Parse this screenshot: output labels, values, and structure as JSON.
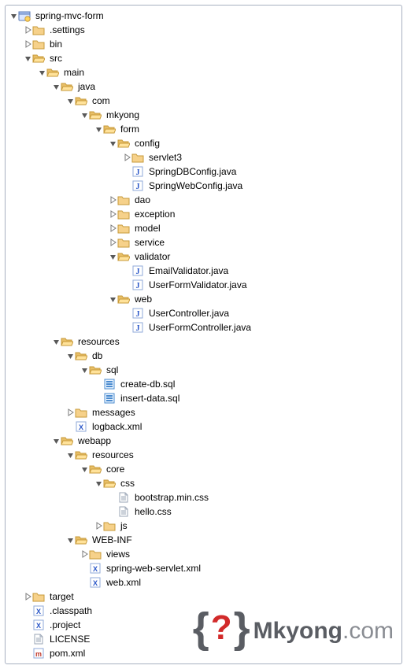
{
  "watermark": {
    "brand": "Mkyong",
    "suffix": ".com"
  },
  "tree": [
    {
      "depth": 0,
      "expand": "open",
      "icon": "project",
      "label": "spring-mvc-form"
    },
    {
      "depth": 1,
      "expand": "closed",
      "icon": "folder",
      "label": ".settings"
    },
    {
      "depth": 1,
      "expand": "closed",
      "icon": "folder",
      "label": "bin"
    },
    {
      "depth": 1,
      "expand": "open",
      "icon": "folder-open",
      "label": "src"
    },
    {
      "depth": 2,
      "expand": "open",
      "icon": "folder-open",
      "label": "main"
    },
    {
      "depth": 3,
      "expand": "open",
      "icon": "folder-open",
      "label": "java"
    },
    {
      "depth": 4,
      "expand": "open",
      "icon": "folder-open",
      "label": "com"
    },
    {
      "depth": 5,
      "expand": "open",
      "icon": "folder-open",
      "label": "mkyong"
    },
    {
      "depth": 6,
      "expand": "open",
      "icon": "folder-open",
      "label": "form"
    },
    {
      "depth": 7,
      "expand": "open",
      "icon": "folder-open",
      "label": "config"
    },
    {
      "depth": 8,
      "expand": "closed",
      "icon": "folder",
      "label": "servlet3"
    },
    {
      "depth": 8,
      "expand": "none",
      "icon": "java",
      "label": "SpringDBConfig.java"
    },
    {
      "depth": 8,
      "expand": "none",
      "icon": "java",
      "label": "SpringWebConfig.java"
    },
    {
      "depth": 7,
      "expand": "closed",
      "icon": "folder",
      "label": "dao"
    },
    {
      "depth": 7,
      "expand": "closed",
      "icon": "folder",
      "label": "exception"
    },
    {
      "depth": 7,
      "expand": "closed",
      "icon": "folder",
      "label": "model"
    },
    {
      "depth": 7,
      "expand": "closed",
      "icon": "folder",
      "label": "service"
    },
    {
      "depth": 7,
      "expand": "open",
      "icon": "folder-open",
      "label": "validator"
    },
    {
      "depth": 8,
      "expand": "none",
      "icon": "java",
      "label": "EmailValidator.java"
    },
    {
      "depth": 8,
      "expand": "none",
      "icon": "java",
      "label": "UserFormValidator.java"
    },
    {
      "depth": 7,
      "expand": "open",
      "icon": "folder-open",
      "label": "web"
    },
    {
      "depth": 8,
      "expand": "none",
      "icon": "java",
      "label": "UserController.java"
    },
    {
      "depth": 8,
      "expand": "none",
      "icon": "java",
      "label": "UserFormController.java"
    },
    {
      "depth": 3,
      "expand": "open",
      "icon": "folder-open",
      "label": "resources"
    },
    {
      "depth": 4,
      "expand": "open",
      "icon": "folder-open",
      "label": "db"
    },
    {
      "depth": 5,
      "expand": "open",
      "icon": "folder-open",
      "label": "sql"
    },
    {
      "depth": 6,
      "expand": "none",
      "icon": "sql",
      "label": "create-db.sql"
    },
    {
      "depth": 6,
      "expand": "none",
      "icon": "sql",
      "label": "insert-data.sql"
    },
    {
      "depth": 4,
      "expand": "closed",
      "icon": "folder",
      "label": "messages"
    },
    {
      "depth": 4,
      "expand": "none",
      "icon": "xml",
      "label": "logback.xml"
    },
    {
      "depth": 3,
      "expand": "open",
      "icon": "folder-open",
      "label": "webapp"
    },
    {
      "depth": 4,
      "expand": "open",
      "icon": "folder-open",
      "label": "resources"
    },
    {
      "depth": 5,
      "expand": "open",
      "icon": "folder-open",
      "label": "core"
    },
    {
      "depth": 6,
      "expand": "open",
      "icon": "folder-open",
      "label": "css"
    },
    {
      "depth": 7,
      "expand": "none",
      "icon": "file",
      "label": "bootstrap.min.css"
    },
    {
      "depth": 7,
      "expand": "none",
      "icon": "file",
      "label": "hello.css"
    },
    {
      "depth": 6,
      "expand": "closed",
      "icon": "folder",
      "label": "js"
    },
    {
      "depth": 4,
      "expand": "open",
      "icon": "folder-open",
      "label": "WEB-INF"
    },
    {
      "depth": 5,
      "expand": "closed",
      "icon": "folder",
      "label": "views"
    },
    {
      "depth": 5,
      "expand": "none",
      "icon": "xml",
      "label": "spring-web-servlet.xml"
    },
    {
      "depth": 5,
      "expand": "none",
      "icon": "xml",
      "label": "web.xml"
    },
    {
      "depth": 1,
      "expand": "closed",
      "icon": "folder",
      "label": "target"
    },
    {
      "depth": 1,
      "expand": "none",
      "icon": "xml",
      "label": ".classpath"
    },
    {
      "depth": 1,
      "expand": "none",
      "icon": "xml",
      "label": ".project"
    },
    {
      "depth": 1,
      "expand": "none",
      "icon": "file",
      "label": "LICENSE"
    },
    {
      "depth": 1,
      "expand": "none",
      "icon": "maven",
      "label": "pom.xml"
    }
  ]
}
